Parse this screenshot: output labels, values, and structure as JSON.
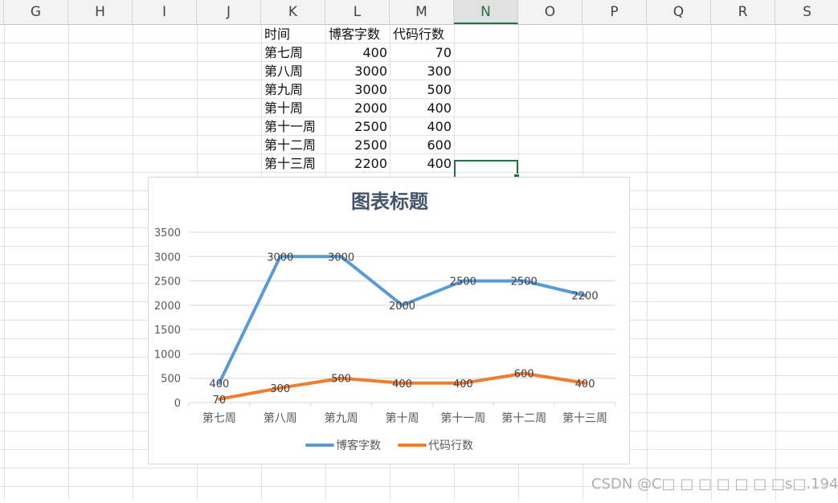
{
  "column_headers": [
    "G",
    "H",
    "I",
    "J",
    "K",
    "L",
    "M",
    "N",
    "O",
    "P",
    "Q",
    "R",
    "S"
  ],
  "active_column": "N",
  "table": {
    "header": [
      "时间",
      "博客字数",
      "代码行数"
    ],
    "rows": [
      [
        "第七周",
        "400",
        "70"
      ],
      [
        "第八周",
        "3000",
        "300"
      ],
      [
        "第九周",
        "3000",
        "500"
      ],
      [
        "第十周",
        "2000",
        "400"
      ],
      [
        "第十一周",
        "2500",
        "400"
      ],
      [
        "第十二周",
        "2500",
        "600"
      ],
      [
        "第十三周",
        "2200",
        "400"
      ]
    ]
  },
  "chart_data": {
    "type": "line",
    "title": "图表标题",
    "categories": [
      "第七周",
      "第八周",
      "第九周",
      "第十周",
      "第十一周",
      "第十二周",
      "第十三周"
    ],
    "series": [
      {
        "name": "博客字数",
        "values": [
          400,
          3000,
          3000,
          2000,
          2500,
          2500,
          2200
        ],
        "color": "#5b9bd5"
      },
      {
        "name": "代码行数",
        "values": [
          70,
          300,
          500,
          400,
          400,
          600,
          400
        ],
        "color": "#ed7d31"
      }
    ],
    "ylim": [
      0,
      3500
    ],
    "yticks": [
      0,
      500,
      1000,
      1500,
      2000,
      2500,
      3000,
      3500
    ],
    "grid": true,
    "data_labels": true,
    "legend": "bottom"
  },
  "colors": {
    "selection": "#217346",
    "gridline": "#e4e4e4",
    "title": "#44546a"
  },
  "watermark": "CSDN @C□ □ □ □ □ □ □s□.194"
}
